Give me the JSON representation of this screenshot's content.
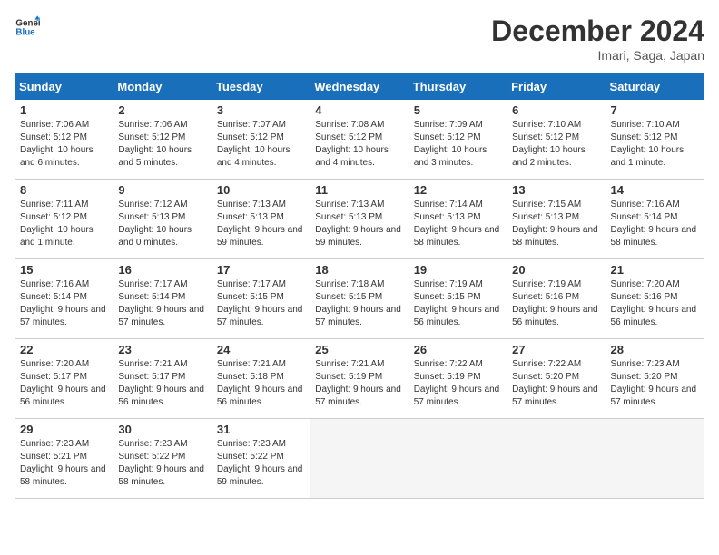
{
  "header": {
    "logo_line1": "General",
    "logo_line2": "Blue",
    "month_title": "December 2024",
    "location": "Imari, Saga, Japan"
  },
  "days_of_week": [
    "Sunday",
    "Monday",
    "Tuesday",
    "Wednesday",
    "Thursday",
    "Friday",
    "Saturday"
  ],
  "weeks": [
    [
      {
        "day": "1",
        "sunrise": "Sunrise: 7:06 AM",
        "sunset": "Sunset: 5:12 PM",
        "daylight": "Daylight: 10 hours and 6 minutes."
      },
      {
        "day": "2",
        "sunrise": "Sunrise: 7:06 AM",
        "sunset": "Sunset: 5:12 PM",
        "daylight": "Daylight: 10 hours and 5 minutes."
      },
      {
        "day": "3",
        "sunrise": "Sunrise: 7:07 AM",
        "sunset": "Sunset: 5:12 PM",
        "daylight": "Daylight: 10 hours and 4 minutes."
      },
      {
        "day": "4",
        "sunrise": "Sunrise: 7:08 AM",
        "sunset": "Sunset: 5:12 PM",
        "daylight": "Daylight: 10 hours and 4 minutes."
      },
      {
        "day": "5",
        "sunrise": "Sunrise: 7:09 AM",
        "sunset": "Sunset: 5:12 PM",
        "daylight": "Daylight: 10 hours and 3 minutes."
      },
      {
        "day": "6",
        "sunrise": "Sunrise: 7:10 AM",
        "sunset": "Sunset: 5:12 PM",
        "daylight": "Daylight: 10 hours and 2 minutes."
      },
      {
        "day": "7",
        "sunrise": "Sunrise: 7:10 AM",
        "sunset": "Sunset: 5:12 PM",
        "daylight": "Daylight: 10 hours and 1 minute."
      }
    ],
    [
      {
        "day": "8",
        "sunrise": "Sunrise: 7:11 AM",
        "sunset": "Sunset: 5:12 PM",
        "daylight": "Daylight: 10 hours and 1 minute."
      },
      {
        "day": "9",
        "sunrise": "Sunrise: 7:12 AM",
        "sunset": "Sunset: 5:13 PM",
        "daylight": "Daylight: 10 hours and 0 minutes."
      },
      {
        "day": "10",
        "sunrise": "Sunrise: 7:13 AM",
        "sunset": "Sunset: 5:13 PM",
        "daylight": "Daylight: 9 hours and 59 minutes."
      },
      {
        "day": "11",
        "sunrise": "Sunrise: 7:13 AM",
        "sunset": "Sunset: 5:13 PM",
        "daylight": "Daylight: 9 hours and 59 minutes."
      },
      {
        "day": "12",
        "sunrise": "Sunrise: 7:14 AM",
        "sunset": "Sunset: 5:13 PM",
        "daylight": "Daylight: 9 hours and 58 minutes."
      },
      {
        "day": "13",
        "sunrise": "Sunrise: 7:15 AM",
        "sunset": "Sunset: 5:13 PM",
        "daylight": "Daylight: 9 hours and 58 minutes."
      },
      {
        "day": "14",
        "sunrise": "Sunrise: 7:16 AM",
        "sunset": "Sunset: 5:14 PM",
        "daylight": "Daylight: 9 hours and 58 minutes."
      }
    ],
    [
      {
        "day": "15",
        "sunrise": "Sunrise: 7:16 AM",
        "sunset": "Sunset: 5:14 PM",
        "daylight": "Daylight: 9 hours and 57 minutes."
      },
      {
        "day": "16",
        "sunrise": "Sunrise: 7:17 AM",
        "sunset": "Sunset: 5:14 PM",
        "daylight": "Daylight: 9 hours and 57 minutes."
      },
      {
        "day": "17",
        "sunrise": "Sunrise: 7:17 AM",
        "sunset": "Sunset: 5:15 PM",
        "daylight": "Daylight: 9 hours and 57 minutes."
      },
      {
        "day": "18",
        "sunrise": "Sunrise: 7:18 AM",
        "sunset": "Sunset: 5:15 PM",
        "daylight": "Daylight: 9 hours and 57 minutes."
      },
      {
        "day": "19",
        "sunrise": "Sunrise: 7:19 AM",
        "sunset": "Sunset: 5:15 PM",
        "daylight": "Daylight: 9 hours and 56 minutes."
      },
      {
        "day": "20",
        "sunrise": "Sunrise: 7:19 AM",
        "sunset": "Sunset: 5:16 PM",
        "daylight": "Daylight: 9 hours and 56 minutes."
      },
      {
        "day": "21",
        "sunrise": "Sunrise: 7:20 AM",
        "sunset": "Sunset: 5:16 PM",
        "daylight": "Daylight: 9 hours and 56 minutes."
      }
    ],
    [
      {
        "day": "22",
        "sunrise": "Sunrise: 7:20 AM",
        "sunset": "Sunset: 5:17 PM",
        "daylight": "Daylight: 9 hours and 56 minutes."
      },
      {
        "day": "23",
        "sunrise": "Sunrise: 7:21 AM",
        "sunset": "Sunset: 5:17 PM",
        "daylight": "Daylight: 9 hours and 56 minutes."
      },
      {
        "day": "24",
        "sunrise": "Sunrise: 7:21 AM",
        "sunset": "Sunset: 5:18 PM",
        "daylight": "Daylight: 9 hours and 56 minutes."
      },
      {
        "day": "25",
        "sunrise": "Sunrise: 7:21 AM",
        "sunset": "Sunset: 5:19 PM",
        "daylight": "Daylight: 9 hours and 57 minutes."
      },
      {
        "day": "26",
        "sunrise": "Sunrise: 7:22 AM",
        "sunset": "Sunset: 5:19 PM",
        "daylight": "Daylight: 9 hours and 57 minutes."
      },
      {
        "day": "27",
        "sunrise": "Sunrise: 7:22 AM",
        "sunset": "Sunset: 5:20 PM",
        "daylight": "Daylight: 9 hours and 57 minutes."
      },
      {
        "day": "28",
        "sunrise": "Sunrise: 7:23 AM",
        "sunset": "Sunset: 5:20 PM",
        "daylight": "Daylight: 9 hours and 57 minutes."
      }
    ],
    [
      {
        "day": "29",
        "sunrise": "Sunrise: 7:23 AM",
        "sunset": "Sunset: 5:21 PM",
        "daylight": "Daylight: 9 hours and 58 minutes."
      },
      {
        "day": "30",
        "sunrise": "Sunrise: 7:23 AM",
        "sunset": "Sunset: 5:22 PM",
        "daylight": "Daylight: 9 hours and 58 minutes."
      },
      {
        "day": "31",
        "sunrise": "Sunrise: 7:23 AM",
        "sunset": "Sunset: 5:22 PM",
        "daylight": "Daylight: 9 hours and 59 minutes."
      },
      {
        "day": "",
        "sunrise": "",
        "sunset": "",
        "daylight": ""
      },
      {
        "day": "",
        "sunrise": "",
        "sunset": "",
        "daylight": ""
      },
      {
        "day": "",
        "sunrise": "",
        "sunset": "",
        "daylight": ""
      },
      {
        "day": "",
        "sunrise": "",
        "sunset": "",
        "daylight": ""
      }
    ]
  ]
}
